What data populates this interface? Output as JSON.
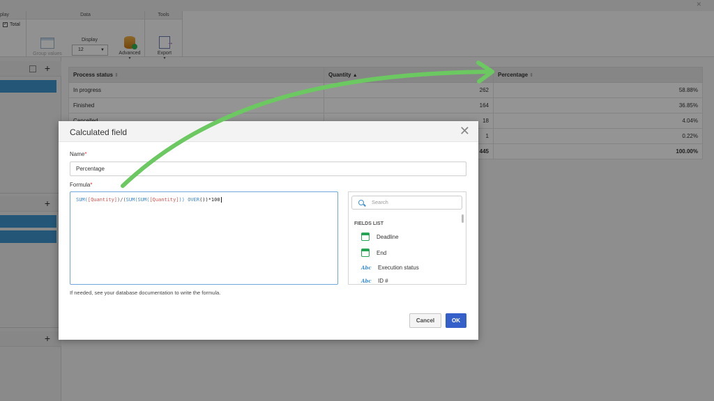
{
  "ribbon": {
    "display_group_label": "play",
    "total_checkbox_label": "Total",
    "data_group_label": "Data",
    "group_values_label": "Group values",
    "display_label": "Display",
    "display_value": "12",
    "advanced_label": "Advanced",
    "tools_group_label": "Tools",
    "export_label": "Export"
  },
  "table": {
    "columns": [
      "Process status",
      "Quantity",
      "Percentage"
    ],
    "rows": [
      {
        "status": "In progress",
        "quantity": "262",
        "percentage": "58.88%"
      },
      {
        "status": "Finished",
        "quantity": "164",
        "percentage": "36.85%"
      },
      {
        "status": "Cancelled",
        "quantity": "18",
        "percentage": "4.04%"
      },
      {
        "status": "",
        "quantity": "1",
        "percentage": "0.22%"
      }
    ],
    "total": {
      "quantity": "445",
      "percentage": "100.00%"
    }
  },
  "dialog": {
    "title": "Calculated field",
    "name_label": "Name",
    "name_value": "Percentage",
    "formula_label": "Formula",
    "formula": {
      "p1": "SUM(",
      "p2": "[Quantity]",
      "p3": ")/(",
      "p4": "SUM(SUM(",
      "p5": "[Quantity]",
      "p6": ")) ",
      "p7": "OVER",
      "p8": "())*100"
    },
    "hint": "If needed, see your database documentation to write the formula.",
    "search_placeholder": "Search",
    "fields_list_label": "FIELDS LIST",
    "fields": [
      {
        "label": "Deadline",
        "icon": "calendar-icon"
      },
      {
        "label": "End",
        "icon": "calendar-icon"
      },
      {
        "label": "Execution status",
        "icon": "text-field-icon"
      },
      {
        "label": "ID #",
        "icon": "text-field-icon"
      }
    ],
    "text_icon_label": "Abc",
    "cancel_label": "Cancel",
    "ok_label": "OK"
  },
  "colors": {
    "ok_button": "#3560c9",
    "required_marker": "#e0332f",
    "annotation_arrow": "#6cc860",
    "selected_item": "#3f94cd"
  }
}
